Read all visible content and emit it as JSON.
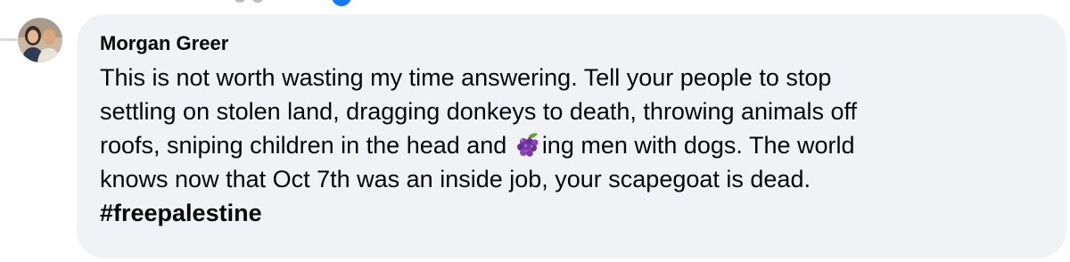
{
  "comment": {
    "author": "Morgan Greer",
    "lines": {
      "l1": "This is not worth wasting my time answering. Tell your people to stop",
      "l2": "settling on stolen land, dragging donkeys to death, throwing animals off",
      "l3_before": "roofs, sniping children in the head and ",
      "l3_after": "ing men with dogs. The world",
      "l4": "knows now that Oct 7th was an inside job, your scapegoat is dead."
    },
    "hashtag": "#freepalestine",
    "inline_emoji": "grapes-emoji"
  },
  "colors": {
    "bubble_background": "#f0f2f5",
    "text": "#050505",
    "reaction_blue": "#1877f2"
  }
}
